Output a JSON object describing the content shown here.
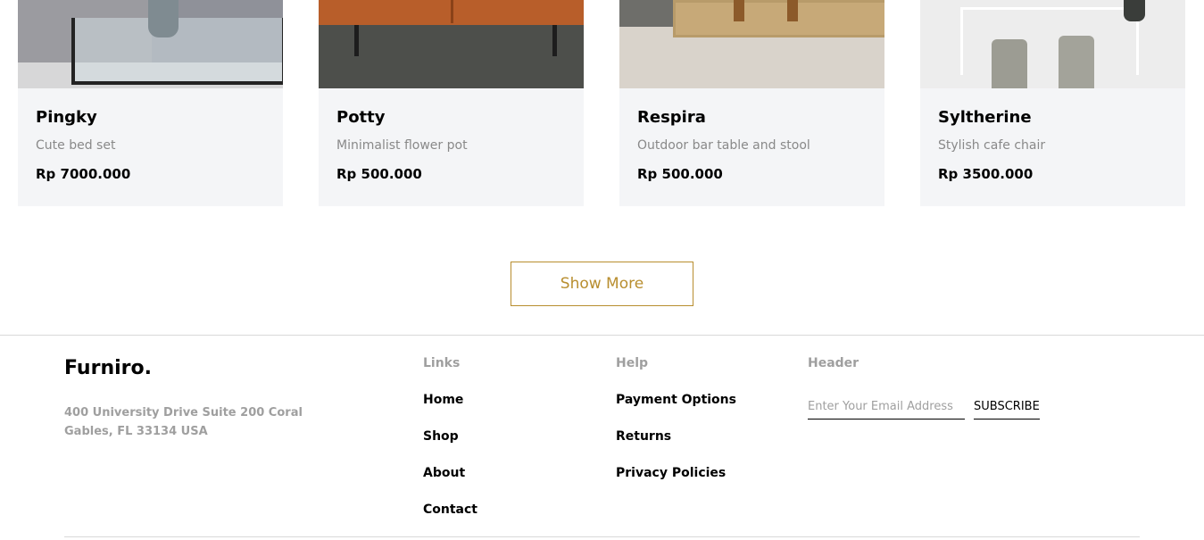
{
  "products": [
    {
      "name": "Pingky",
      "description": "Cute bed set",
      "price": "Rp 7000.000"
    },
    {
      "name": "Potty",
      "description": "Minimalist flower pot",
      "price": "Rp 500.000"
    },
    {
      "name": "Respira",
      "description": "Outdoor bar table and stool",
      "price": "Rp 500.000"
    },
    {
      "name": "Syltherine",
      "description": "Stylish cafe chair",
      "price": "Rp 3500.000"
    }
  ],
  "show_more_label": "Show More",
  "footer": {
    "brand": "Furniro.",
    "address": "400 University Drive Suite 200 Coral Gables, FL 33134 USA",
    "links": {
      "heading": "Links",
      "items": [
        "Home",
        "Shop",
        "About",
        "Contact"
      ]
    },
    "help": {
      "heading": "Help",
      "items": [
        "Payment Options",
        "Returns",
        "Privacy Policies"
      ]
    },
    "newsletter": {
      "heading": "Header",
      "placeholder": "Enter Your Email Address",
      "button_label": "SUBSCRIBE"
    }
  },
  "colors": {
    "accent": "#b88e2f",
    "card_bg": "#f4f5f7",
    "muted_text": "#9f9f9f",
    "desc_text": "#898989"
  }
}
